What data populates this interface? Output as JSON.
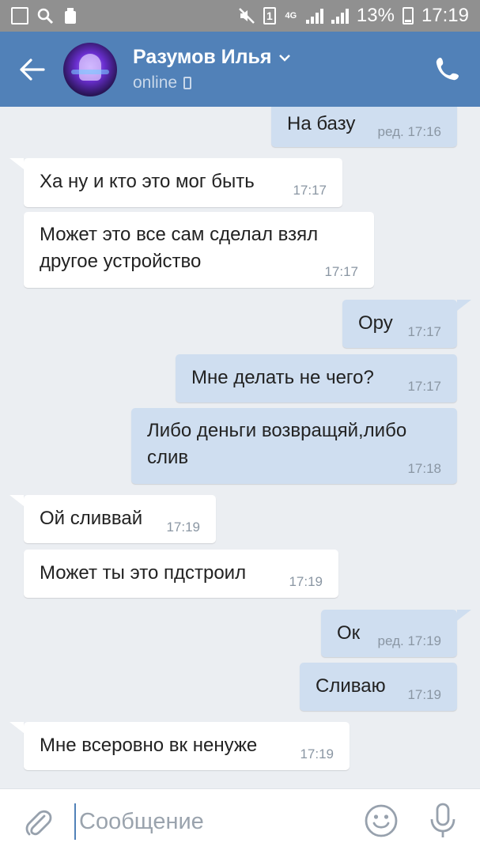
{
  "status_bar": {
    "battery": "13%",
    "time": "17:19",
    "network": "4G",
    "sim": "1"
  },
  "header": {
    "contact_name": "Разумов Илья",
    "status": "online"
  },
  "colors": {
    "header": "#5181b8",
    "outgoing_bubble": "#cfdef0",
    "incoming_bubble": "#ffffff",
    "background": "#ebeef2"
  },
  "messages": [
    {
      "direction": "out",
      "text": "На базу",
      "time": "ред. 17:16"
    },
    {
      "direction": "in",
      "text": "Ха ну и кто это мог быть",
      "time": "17:17"
    },
    {
      "direction": "in",
      "text": "Может это все сам сделал взял другое устройство",
      "time": "17:17"
    },
    {
      "direction": "out",
      "text": "Ору",
      "time": "17:17"
    },
    {
      "direction": "out",
      "text": "Мне делать не чего?",
      "time": "17:17"
    },
    {
      "direction": "out",
      "text": "Либо деньги возвращяй,либо слив",
      "time": "17:18"
    },
    {
      "direction": "in",
      "text": "Ой сливвай",
      "time": "17:19"
    },
    {
      "direction": "in",
      "text": "Может ты это пдстроил",
      "time": "17:19"
    },
    {
      "direction": "out",
      "text": "Ок",
      "time": "ред. 17:19"
    },
    {
      "direction": "out",
      "text": "Сливаю",
      "time": "17:19"
    },
    {
      "direction": "in",
      "text": "Мне всеровно вк ненуже",
      "time": "17:19"
    }
  ],
  "composer": {
    "placeholder": "Сообщение"
  },
  "icons": [
    "gallery-icon",
    "search-icon",
    "recycle-icon",
    "mute-icon",
    "sim-icon",
    "signal-icon",
    "battery-icon",
    "back-arrow-icon",
    "chevron-down-icon",
    "mobile-icon",
    "phone-icon",
    "paperclip-icon",
    "emoji-icon",
    "microphone-icon"
  ]
}
